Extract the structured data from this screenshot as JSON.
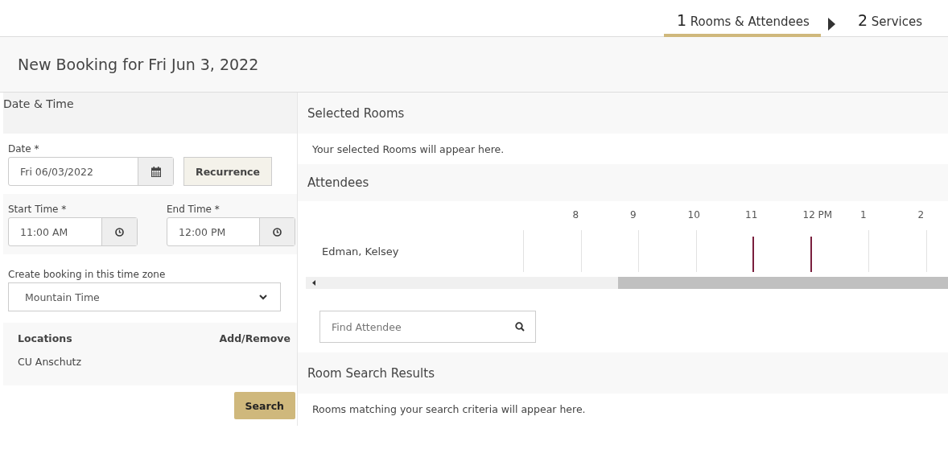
{
  "steps": [
    {
      "number": "1",
      "label": "Rooms & Attendees",
      "selected": true
    },
    {
      "number": "2",
      "label": "Services",
      "selected": false
    }
  ],
  "title": "New Booking for Fri Jun 3, 2022",
  "date_time": {
    "heading": "Date & Time",
    "date_label": "Date *",
    "date_value": "Fri 06/03/2022",
    "recurrence_button": "Recurrence",
    "start_label": "Start Time *",
    "start_value": "11:00 AM",
    "end_label": "End Time *",
    "end_value": "12:00 PM",
    "timezone_label": "Create booking in this time zone",
    "timezone_value": "Mountain Time"
  },
  "locations": {
    "heading": "Locations",
    "action": "Add/Remove",
    "items": [
      "CU Anschutz"
    ]
  },
  "search_button": "Search",
  "selected_rooms": {
    "heading": "Selected Rooms",
    "message": "Your selected Rooms will appear here."
  },
  "attendees": {
    "heading": "Attendees",
    "hours": [
      {
        "marked": false
      },
      {
        "label": "8",
        "marked": false
      },
      {
        "label": "9",
        "marked": false
      },
      {
        "label": "10",
        "marked": false
      },
      {
        "label": "11",
        "marked": true
      },
      {
        "label": "12 PM",
        "marked": true
      },
      {
        "label": "1",
        "marked": false
      },
      {
        "label": "2",
        "marked": false
      }
    ],
    "people": [
      "Edman, Kelsey"
    ],
    "find_placeholder": "Find Attendee"
  },
  "results": {
    "heading": "Room Search Results",
    "message": "Rooms matching your search criteria will appear here."
  }
}
